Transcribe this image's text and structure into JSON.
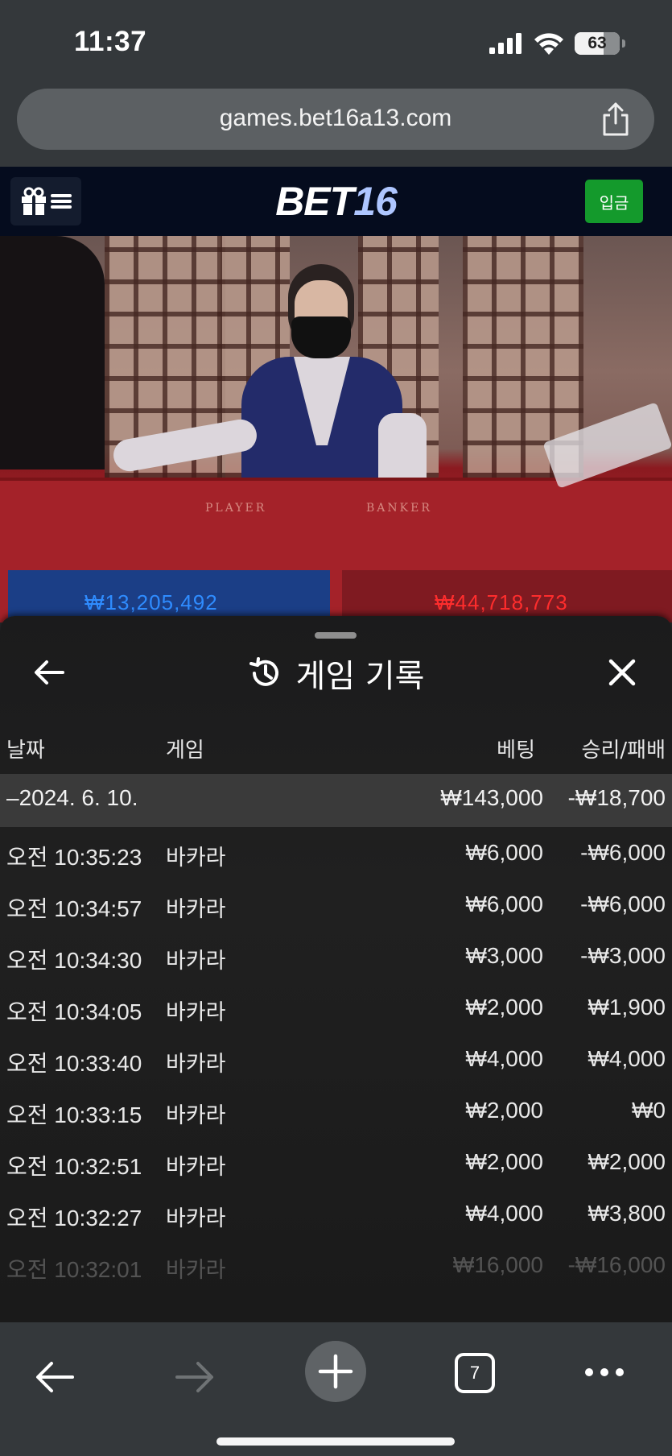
{
  "status_bar": {
    "time": "11:37",
    "battery": "63"
  },
  "browser": {
    "url": "games.bet16a13.com"
  },
  "header": {
    "logo_main": "BET",
    "logo_num": "16",
    "deposit_label": "입금"
  },
  "video": {
    "player_label": "PLAYER",
    "banker_label": "BANKER",
    "player_amount": "₩13,205,492",
    "banker_amount": "₩44,718,773"
  },
  "history": {
    "title": "게임 기록",
    "columns": {
      "date": "날짜",
      "game": "게임",
      "bet": "베팅",
      "result": "승리/패배"
    },
    "day": {
      "date": "–2024. 6. 10.",
      "bet": "₩143,000",
      "result": "-₩18,700"
    },
    "rows": [
      {
        "time": "오전 10:35:23",
        "game": "바카라",
        "bet": "₩6,000",
        "result": "-₩6,000"
      },
      {
        "time": "오전 10:34:57",
        "game": "바카라",
        "bet": "₩6,000",
        "result": "-₩6,000"
      },
      {
        "time": "오전 10:34:30",
        "game": "바카라",
        "bet": "₩3,000",
        "result": "-₩3,000"
      },
      {
        "time": "오전 10:34:05",
        "game": "바카라",
        "bet": "₩2,000",
        "result": "₩1,900"
      },
      {
        "time": "오전 10:33:40",
        "game": "바카라",
        "bet": "₩4,000",
        "result": "₩4,000"
      },
      {
        "time": "오전 10:33:15",
        "game": "바카라",
        "bet": "₩2,000",
        "result": "₩0"
      },
      {
        "time": "오전 10:32:51",
        "game": "바카라",
        "bet": "₩2,000",
        "result": "₩2,000"
      },
      {
        "time": "오전 10:32:27",
        "game": "바카라",
        "bet": "₩4,000",
        "result": "₩3,800"
      },
      {
        "time": "오전 10:32:01",
        "game": "바카라",
        "bet": "₩16,000",
        "result": "-₩16,000"
      }
    ]
  },
  "toolbar": {
    "tab_count": "7"
  },
  "colors": {
    "accent_green": "#149a2c",
    "player_blue": "#2f8cff",
    "banker_red": "#ff2d2d"
  },
  "icons": [
    "signal-icon",
    "wifi-icon",
    "battery-icon",
    "share-icon",
    "gift-icon",
    "menu-icon",
    "history-icon",
    "back-arrow-icon",
    "close-icon",
    "forward-arrow-icon",
    "plus-icon",
    "tabs-icon",
    "more-icon"
  ]
}
